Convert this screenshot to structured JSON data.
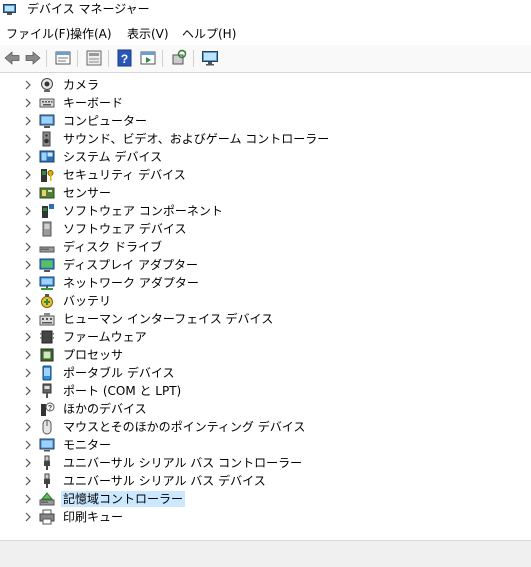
{
  "window": {
    "title": "デバイス マネージャー"
  },
  "menu": [
    {
      "label": "ファイル(F)"
    },
    {
      "label": "操作(A)"
    },
    {
      "label": "表示(V)"
    },
    {
      "label": "ヘルプ(H)"
    }
  ],
  "toolbar": {
    "buttons": [
      "back-icon",
      "forward-icon",
      "properties-icon",
      "grid-view-icon",
      "help-icon",
      "run-icon",
      "scan-hardware-icon",
      "monitor-icon"
    ]
  },
  "tree": {
    "items": [
      {
        "label": "カメラ",
        "icon": "camera-icon"
      },
      {
        "label": "キーボード",
        "icon": "keyboard-icon"
      },
      {
        "label": "コンピューター",
        "icon": "computer-icon"
      },
      {
        "label": "サウンド、ビデオ、およびゲーム コントローラー",
        "icon": "speaker-icon"
      },
      {
        "label": "システム デバイス",
        "icon": "system-device-icon"
      },
      {
        "label": "セキュリティ デバイス",
        "icon": "security-key-icon"
      },
      {
        "label": "センサー",
        "icon": "sensor-icon"
      },
      {
        "label": "ソフトウェア コンポーネント",
        "icon": "software-component-icon"
      },
      {
        "label": "ソフトウェア デバイス",
        "icon": "software-device-icon"
      },
      {
        "label": "ディスク ドライブ",
        "icon": "disk-drive-icon"
      },
      {
        "label": "ディスプレイ アダプター",
        "icon": "display-adapter-icon"
      },
      {
        "label": "ネットワーク アダプター",
        "icon": "network-adapter-icon"
      },
      {
        "label": "バッテリ",
        "icon": "battery-icon"
      },
      {
        "label": "ヒューマン インターフェイス デバイス",
        "icon": "hid-icon"
      },
      {
        "label": "ファームウェア",
        "icon": "firmware-icon"
      },
      {
        "label": "プロセッサ",
        "icon": "processor-icon"
      },
      {
        "label": "ポータブル デバイス",
        "icon": "portable-device-icon"
      },
      {
        "label": "ポート (COM と LPT)",
        "icon": "port-icon"
      },
      {
        "label": "ほかのデバイス",
        "icon": "other-device-icon"
      },
      {
        "label": "マウスとそのほかのポインティング デバイス",
        "icon": "mouse-icon"
      },
      {
        "label": "モニター",
        "icon": "monitor-icon"
      },
      {
        "label": "ユニバーサル シリアル バス コントローラー",
        "icon": "usb-icon"
      },
      {
        "label": "ユニバーサル シリアル バス デバイス",
        "icon": "usb-icon"
      },
      {
        "label": "記憶域コントローラー",
        "icon": "storage-controller-icon",
        "selected": true
      },
      {
        "label": "印刷キュー",
        "icon": "printer-icon"
      }
    ]
  }
}
